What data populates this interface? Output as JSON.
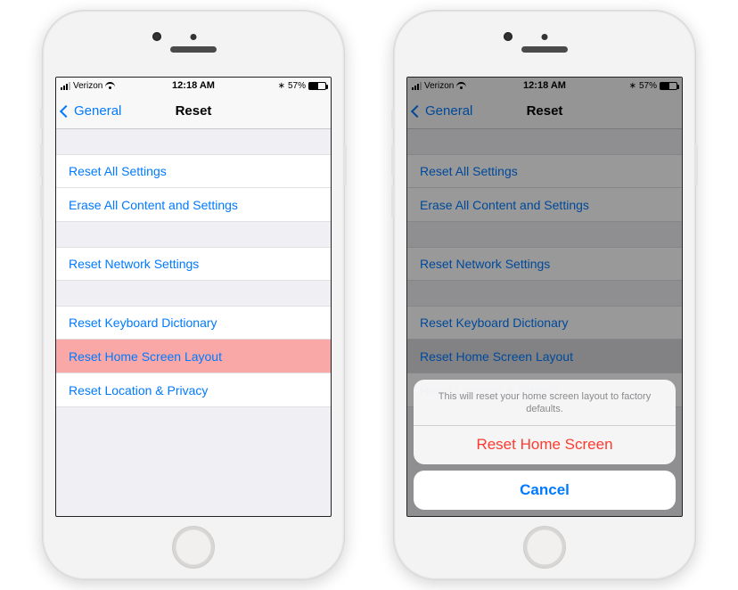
{
  "status": {
    "carrier": "Verizon",
    "time": "12:18 AM",
    "battery_pct": "57%"
  },
  "nav": {
    "back_label": "General",
    "title": "Reset"
  },
  "rows": {
    "reset_all": "Reset All Settings",
    "erase_all": "Erase All Content and Settings",
    "reset_network": "Reset Network Settings",
    "reset_keyboard": "Reset Keyboard Dictionary",
    "reset_home": "Reset Home Screen Layout",
    "reset_location": "Reset Location & Privacy"
  },
  "sheet": {
    "message": "This will reset your home screen layout to factory defaults.",
    "confirm": "Reset Home Screen",
    "cancel": "Cancel"
  }
}
